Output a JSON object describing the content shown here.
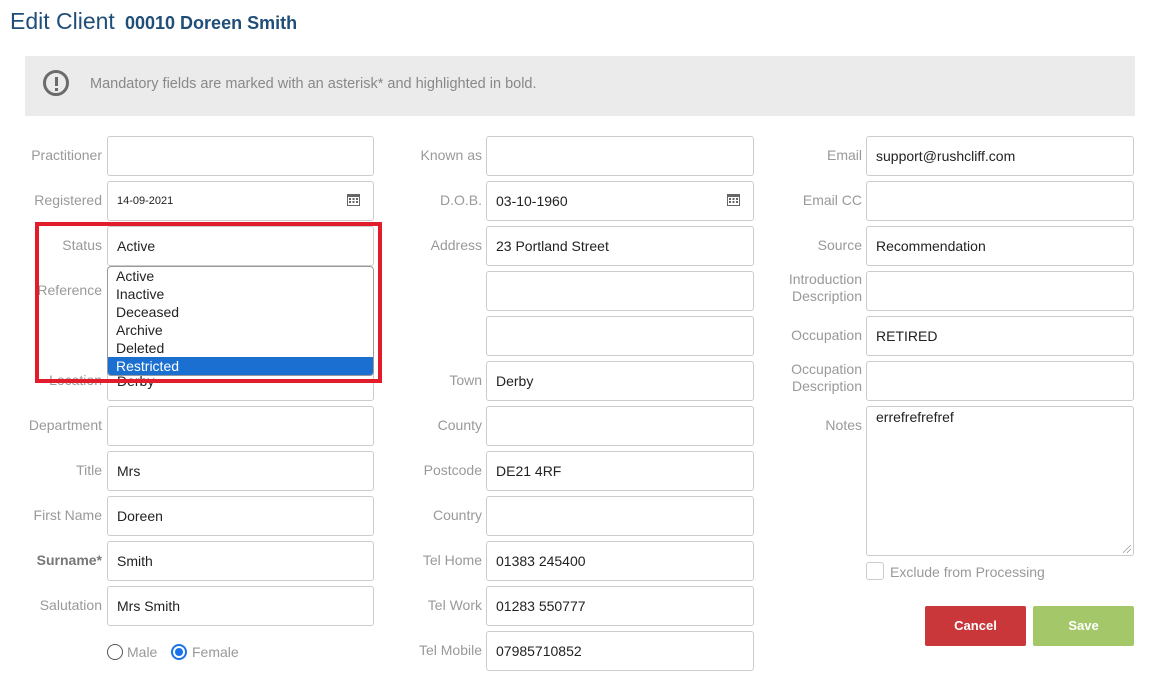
{
  "header": {
    "title": "Edit Client",
    "client_id_name": "00010 Doreen Smith"
  },
  "banner": {
    "icon": "exclamation-circle-icon",
    "text": "Mandatory fields are marked with an asterisk* and highlighted in bold."
  },
  "col1": {
    "practitioner": {
      "label": "Practitioner",
      "value": ""
    },
    "registered": {
      "label": "Registered",
      "value": "14-09-2021",
      "icon": "calendar-icon"
    },
    "status": {
      "label": "Status",
      "value": "Active",
      "options": [
        "Active",
        "Inactive",
        "Deceased",
        "Archive",
        "Deleted",
        "Restricted"
      ],
      "highlighted_option": "Restricted"
    },
    "reference": {
      "label": "Reference",
      "value": ""
    },
    "location": {
      "label": "Location",
      "value": "Derby"
    },
    "department": {
      "label": "Department",
      "value": ""
    },
    "title": {
      "label": "Title",
      "value": "Mrs"
    },
    "first_name": {
      "label": "First Name",
      "value": "Doreen"
    },
    "surname": {
      "label": "Surname*",
      "value": "Smith"
    },
    "salutation": {
      "label": "Salutation",
      "value": "Mrs Smith"
    },
    "gender": {
      "male_label": "Male",
      "female_label": "Female",
      "selected": "Female"
    }
  },
  "col2": {
    "known_as": {
      "label": "Known as",
      "value": ""
    },
    "dob": {
      "label": "D.O.B.",
      "value": "03-10-1960",
      "icon": "calendar-icon"
    },
    "address": {
      "label": "Address",
      "line1": "23 Portland Street",
      "line2": "",
      "line3": ""
    },
    "town": {
      "label": "Town",
      "value": "Derby"
    },
    "county": {
      "label": "County",
      "value": ""
    },
    "postcode": {
      "label": "Postcode",
      "value": "DE21 4RF"
    },
    "country": {
      "label": "Country",
      "value": ""
    },
    "tel_home": {
      "label": "Tel Home",
      "value": "01383 245400"
    },
    "tel_work": {
      "label": "Tel Work",
      "value": "01283 550777"
    },
    "tel_mobile": {
      "label": "Tel Mobile",
      "value": "07985710852"
    }
  },
  "col3": {
    "email": {
      "label": "Email",
      "value": "support@rushcliff.com"
    },
    "email_cc": {
      "label": "Email CC",
      "value": ""
    },
    "source": {
      "label": "Source",
      "value": "Recommendation"
    },
    "intro_desc": {
      "label_line1": "Introduction",
      "label_line2": "Description",
      "value": ""
    },
    "occupation": {
      "label": "Occupation",
      "value": "RETIRED"
    },
    "occupation_desc": {
      "label_line1": "Occupation",
      "label_line2": "Description",
      "value": ""
    },
    "notes": {
      "label": "Notes",
      "value": "errefrefrefref"
    },
    "exclude": {
      "label": "Exclude from Processing",
      "checked": false
    }
  },
  "buttons": {
    "cancel": "Cancel",
    "save": "Save"
  },
  "colors": {
    "heading": "#1f4e79",
    "cancel": "#c9373a",
    "save": "#a3c769",
    "highlight_frame": "#e21c2a",
    "selected_option": "#1a6fd0",
    "radio_accent": "#1a73e8"
  }
}
